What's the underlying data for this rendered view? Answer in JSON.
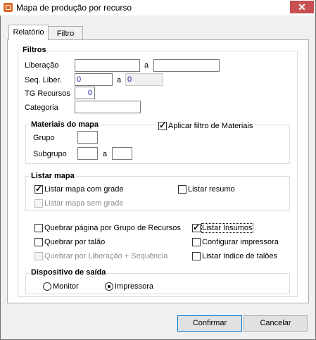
{
  "window": {
    "title": "Mapa de produção por recurso",
    "close_glyph": "✕"
  },
  "tabs": [
    {
      "label": "Relatório"
    },
    {
      "label": "Filtro"
    }
  ],
  "filtros": {
    "label": "Filtros",
    "liberacao": {
      "label": "Liberação",
      "from": "",
      "sep": "a",
      "to": ""
    },
    "seq_liber": {
      "label": "Seq. Liber.",
      "from": "0",
      "sep": "a",
      "to": "0"
    },
    "tg_recursos": {
      "label": "TG Recursos",
      "value": "0"
    },
    "categoria": {
      "label": "Categoria",
      "value": ""
    },
    "materiais": {
      "label": "Materiais do mapa",
      "aplicar_filtro": {
        "label": "Aplicar filtro de Materiais",
        "checked": true
      },
      "grupo": {
        "label": "Grupo",
        "value": ""
      },
      "subgrupo": {
        "label": "Subgrupo",
        "from": "",
        "sep": "a",
        "to": ""
      }
    },
    "listar_mapa": {
      "label": "Listar mapa",
      "com_grade": {
        "label": "Listar mapa com grade",
        "checked": true
      },
      "resumo": {
        "label": "Listar resumo",
        "checked": false
      },
      "sem_grade": {
        "label": "Listar mapa sem grade",
        "checked": false,
        "disabled": true
      }
    },
    "options": {
      "quebrar_pagina": {
        "label": "Quebrar página por Grupo de Recursos",
        "checked": false
      },
      "listar_insumos": {
        "label": "Listar Insumos",
        "checked": true
      },
      "quebrar_talao": {
        "label": "Quebrar por talão",
        "checked": false
      },
      "configurar_impressora": {
        "label": "Configurar impressora",
        "checked": false
      },
      "quebrar_liberacao": {
        "label": "Quebrar por Liberação + Sequência",
        "checked": false,
        "disabled": true
      },
      "listar_indice": {
        "label": "Listar índice de talões",
        "checked": false
      }
    },
    "dispositivo": {
      "label": "Dispositivo de saída",
      "monitor": {
        "label": "Monitor",
        "selected": false
      },
      "impressora": {
        "label": "Impressora",
        "selected": true
      }
    }
  },
  "buttons": {
    "confirmar": "Confirmar",
    "cancelar": "Cancelar"
  }
}
